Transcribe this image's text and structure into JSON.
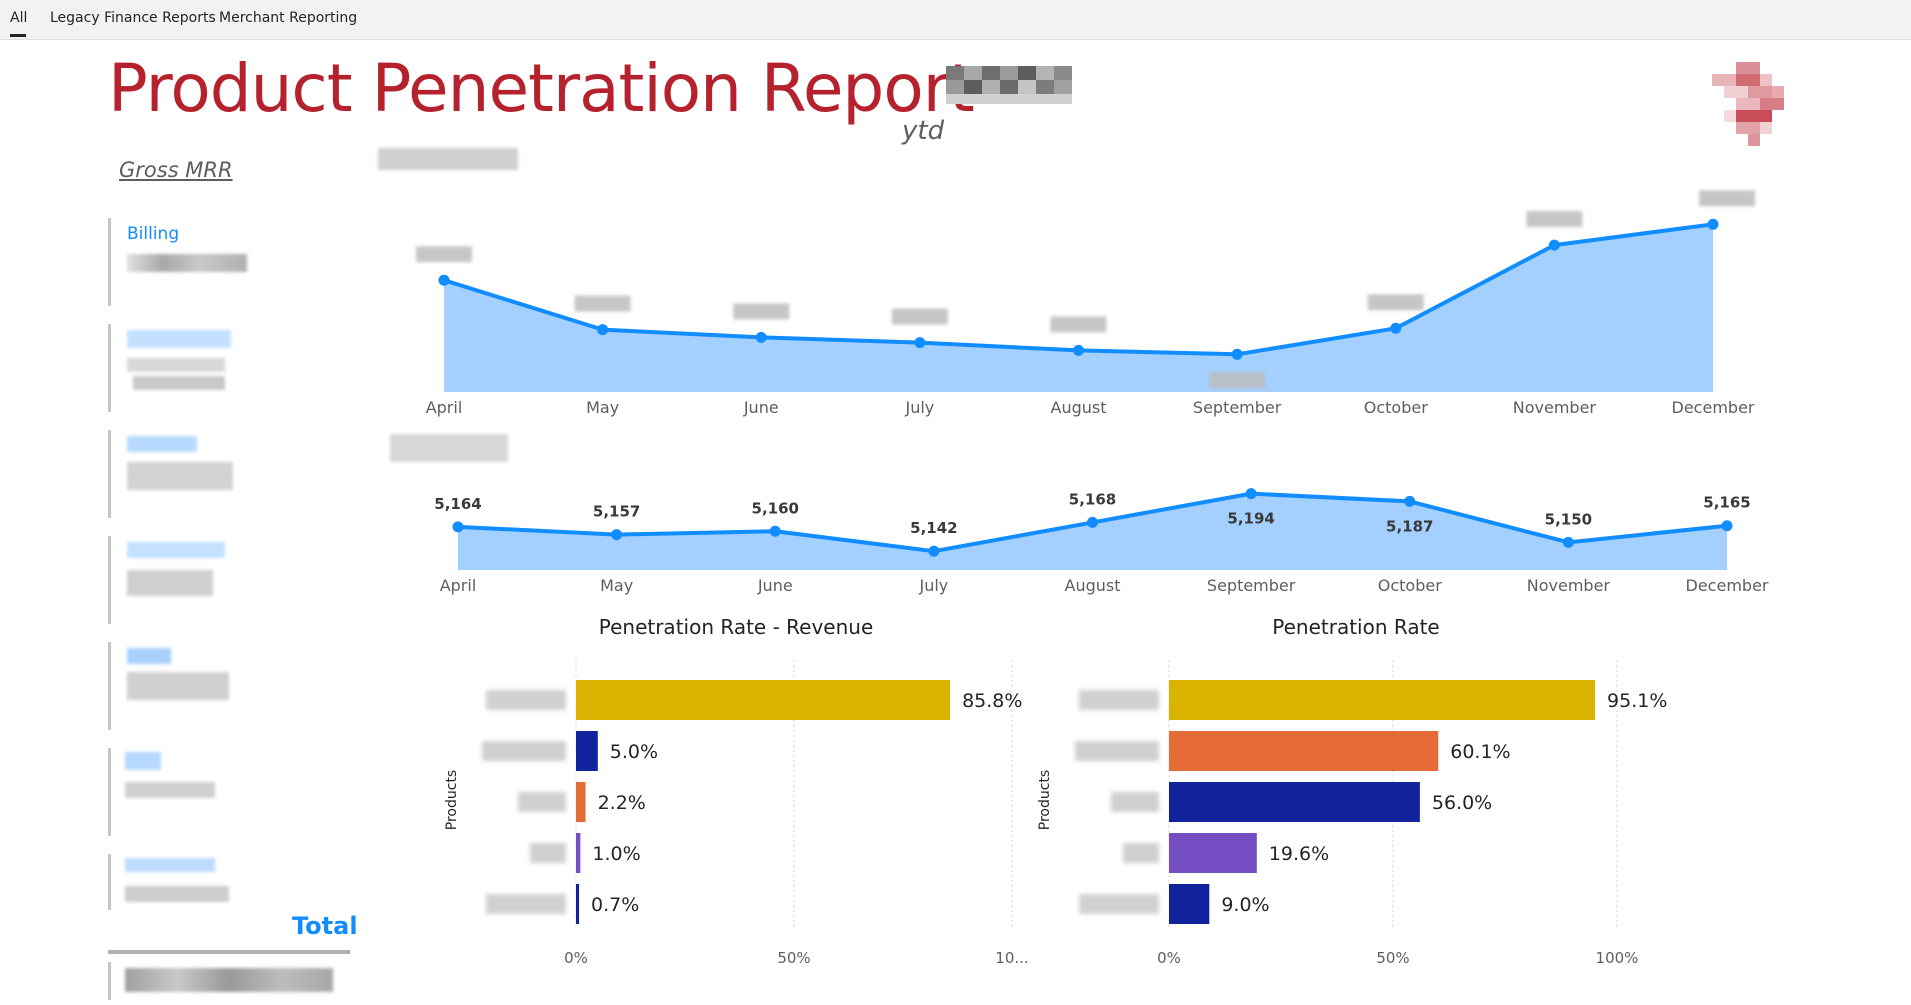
{
  "tabs": {
    "items": [
      {
        "label": "All",
        "active": true
      },
      {
        "label": "Legacy Finance Reports",
        "active": false
      },
      {
        "label": "Merchant Reporting",
        "active": false
      }
    ]
  },
  "header": {
    "title": "Product Penetration Report",
    "ytd_label": "ytd",
    "logo_icon": "pixelated-logo-icon"
  },
  "sidebar": {
    "subtitle": "Gross MRR",
    "first_card_label": "Billing",
    "total_label": "Total"
  },
  "colors": {
    "title": "#b5222d",
    "accent": "#118dff",
    "area_fill": "#a3d0ff",
    "bar_gold": "#d9b300",
    "bar_navy": "#12239e",
    "bar_orange": "#e66c37",
    "bar_purple": "#744ec2"
  },
  "chart_data": [
    {
      "type": "area",
      "x": [
        "April",
        "May",
        "June",
        "July",
        "August",
        "September",
        "October",
        "November",
        "December"
      ],
      "series": [
        {
          "values": [
            0.86,
            0.48,
            0.42,
            0.38,
            0.32,
            0.29,
            0.49,
            1.13,
            1.29
          ]
        }
      ],
      "data_labels": "redacted",
      "ylim": [
        0,
        1.4
      ],
      "grid": false
    },
    {
      "type": "area",
      "x": [
        "April",
        "May",
        "June",
        "July",
        "August",
        "September",
        "October",
        "November",
        "December"
      ],
      "series": [
        {
          "values": [
            5164,
            5157,
            5160,
            5142,
            5168,
            5194,
            5187,
            5150,
            5165
          ]
        }
      ],
      "data_labels": [
        "5,164",
        "5,157",
        "5,160",
        "5,142",
        "5,168",
        "5,194",
        "5,187",
        "5,150",
        "5,165"
      ],
      "ylim": [
        5125,
        5200
      ],
      "grid": false
    },
    {
      "type": "bar",
      "orientation": "horizontal",
      "title": "Penetration Rate - Revenue",
      "ylabel": "Products",
      "values": [
        85.8,
        5.0,
        2.2,
        1.0,
        0.7
      ],
      "data_labels": [
        "85.8%",
        "5.0%",
        "2.2%",
        "1.0%",
        "0.7%"
      ],
      "colors": [
        "#d9b300",
        "#12239e",
        "#e66c37",
        "#744ec2",
        "#12239e"
      ],
      "xlim": [
        0,
        100
      ],
      "xticks": [
        "0%",
        "50%",
        "10..."
      ],
      "grid": true
    },
    {
      "type": "bar",
      "orientation": "horizontal",
      "title": "Penetration Rate",
      "ylabel": "Products",
      "values": [
        95.1,
        60.1,
        56.0,
        19.6,
        9.0
      ],
      "data_labels": [
        "95.1%",
        "60.1%",
        "56.0%",
        "19.6%",
        "9.0%"
      ],
      "colors": [
        "#d9b300",
        "#e66c37",
        "#12239e",
        "#744ec2",
        "#12239e"
      ],
      "xlim": [
        0,
        100
      ],
      "xticks": [
        "0%",
        "50%",
        "100%"
      ],
      "grid": true
    }
  ]
}
